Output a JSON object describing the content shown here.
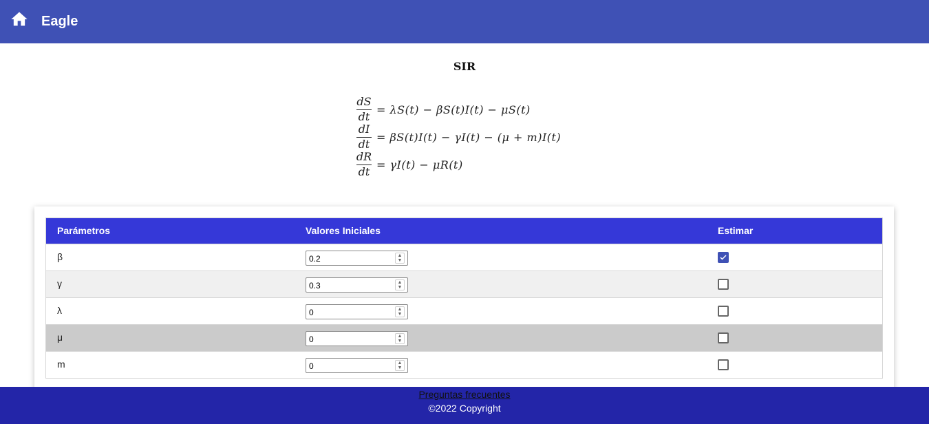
{
  "appbar": {
    "title": "Eagle",
    "home_icon": "home-icon",
    "color": "#3f51b5"
  },
  "model": {
    "title": "SIR",
    "equations": [
      {
        "num": "dS",
        "den": "dt",
        "rhs": "= λS(t) − βS(t)I(t) − μS(t)"
      },
      {
        "num": "dI",
        "den": "dt",
        "rhs": "= βS(t)I(t) − γI(t) − (μ + m)I(t)"
      },
      {
        "num": "dR",
        "den": "dt",
        "rhs": "= γI(t) − μR(t)"
      }
    ]
  },
  "table": {
    "headers": [
      "Parámetros",
      "Valores Iniciales",
      "Estimar"
    ],
    "header_color": "#3538d8",
    "rows": [
      {
        "param": "β",
        "value": "0.2",
        "estimate": true
      },
      {
        "param": "γ",
        "value": "0.3",
        "estimate": false
      },
      {
        "param": "λ",
        "value": "0",
        "estimate": false
      },
      {
        "param": "μ",
        "value": "0",
        "estimate": false
      },
      {
        "param": "m",
        "value": "0",
        "estimate": false
      }
    ]
  },
  "footer": {
    "faq_link": "Preguntas frecuentes",
    "copyright": "©2022 Copyright",
    "color": "#2325a8"
  }
}
